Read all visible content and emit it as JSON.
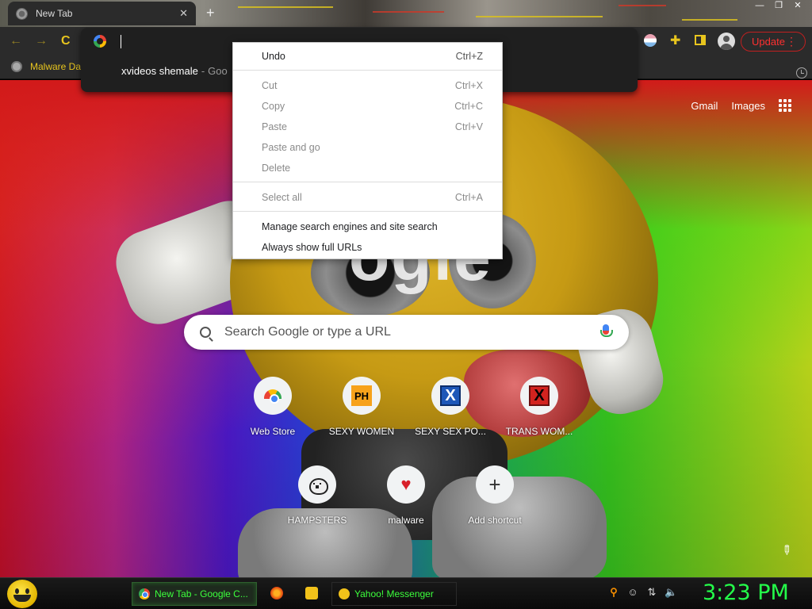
{
  "window": {
    "tab_title": "New Tab",
    "tab_close": "✕",
    "new_tab": "+",
    "controls": [
      "—",
      "❐",
      "✕"
    ]
  },
  "toolbar": {
    "back": "←",
    "forward": "→",
    "reload": "C",
    "update_label": "Update",
    "menu_dots": "⋮",
    "accent_color": "#e8c51e",
    "update_color": "#ff3030"
  },
  "bookmarks": {
    "items": [
      {
        "label": "Malware Da"
      }
    ]
  },
  "omnibox": {
    "value": "",
    "suggestion": {
      "query": "xvideos shemale",
      "separator": "-",
      "source": "Goo"
    }
  },
  "context_menu": {
    "items": [
      {
        "label": "Undo",
        "shortcut": "Ctrl+Z",
        "enabled": true
      },
      {
        "label": "Cut",
        "shortcut": "Ctrl+X",
        "enabled": false
      },
      {
        "label": "Copy",
        "shortcut": "Ctrl+C",
        "enabled": false
      },
      {
        "label": "Paste",
        "shortcut": "Ctrl+V",
        "enabled": false
      },
      {
        "label": "Paste and go",
        "shortcut": "",
        "enabled": false
      },
      {
        "label": "Delete",
        "shortcut": "",
        "enabled": false
      },
      {
        "label": "Select all",
        "shortcut": "Ctrl+A",
        "enabled": false
      },
      {
        "label": "Manage search engines and site search",
        "shortcut": "",
        "enabled": true
      },
      {
        "label": "Always show full URLs",
        "shortcut": "",
        "enabled": true
      }
    ]
  },
  "ntp": {
    "links": [
      "Gmail",
      "Images"
    ],
    "search_placeholder": "Search Google or type a URL",
    "logo_text": "ogle",
    "shortcuts": [
      {
        "label": "Web Store",
        "icon": "web-store-icon"
      },
      {
        "label": "SEXY WOMEN",
        "icon": "ph-icon",
        "icon_text": "PH"
      },
      {
        "label": "SEXY SEX PO...",
        "icon": "x-blue-icon",
        "icon_text": "X"
      },
      {
        "label": "TRANS WOM...",
        "icon": "x-red-icon",
        "icon_text": "X"
      },
      {
        "label": "HAMPSTERS",
        "icon": "hamster-icon"
      },
      {
        "label": "malware",
        "icon": "heart-icon",
        "icon_text": "♥"
      },
      {
        "label": "Add shortcut",
        "icon": "plus-icon",
        "icon_text": "+"
      }
    ],
    "customize_icon": "✎"
  },
  "taskbar": {
    "tasks": [
      {
        "label": "New Tab - Google C...",
        "active": true
      },
      {
        "label": "Yahoo! Messenger",
        "active": false
      }
    ],
    "tray_glyphs": [
      "⚲",
      "☺",
      "⇅",
      "🔈"
    ],
    "clock": "3:23 PM",
    "clock_color": "#24ff4a"
  }
}
